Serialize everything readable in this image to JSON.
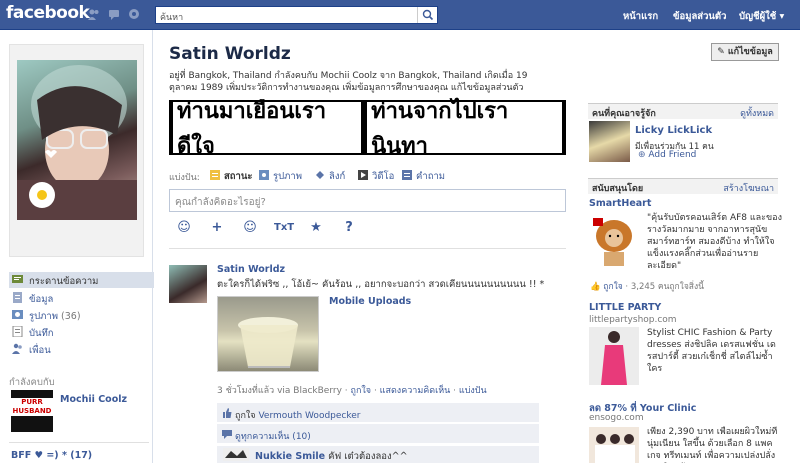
{
  "topbar": {
    "logo": "facebook",
    "search_placeholder": "ค้นหา",
    "nav": [
      "หน้าแรก",
      "ข้อมูลส่วนตัว",
      "บัญชีผู้ใช้ ▾"
    ]
  },
  "profile": {
    "name": "Satin Worldz",
    "info_line1": "อยู่ที่ Bangkok, Thailand   กำลังคบกับ Mochii Coolz   จาก Bangkok, Thailand   เกิดเมื่อ 19",
    "info_line2": "ตุลาคม 1989   เพิ่มประวัติการทำงานของคุณ   เพิ่มข้อมูลการศึกษาของคุณ   แก้ไขข้อมูลส่วนตัว",
    "edit_button": "แก้ไขข้อมูล",
    "banner_tiles": [
      "ท่านมาเยือนเราดีใจ",
      "ท่านจากไปเรานินทา"
    ]
  },
  "left_nav": {
    "items": [
      {
        "label": "กระดานข้อความ",
        "count": ""
      },
      {
        "label": "ข้อมูล",
        "count": ""
      },
      {
        "label": "รูปภาพ",
        "count": "(36)"
      },
      {
        "label": "บันทึก",
        "count": ""
      },
      {
        "label": "เพื่อน",
        "count": ""
      }
    ],
    "relationship_heading": "กำลังคบกับ",
    "relationship_name": "Mochii Coolz",
    "relationship_badge": "PURR HUSBAND",
    "friends_list": "BFF ♥ =) * (17)"
  },
  "composer": {
    "share_label": "แบ่งปัน:",
    "options": [
      "สถานะ",
      "รูปภาพ",
      "ลิงก์",
      "วิดีโอ",
      "คำถาม"
    ],
    "placeholder": "คุณกำลังคิดอะไรอยู่?",
    "tools": [
      "☺",
      "+",
      "☺",
      "TxT",
      "★",
      "?"
    ]
  },
  "story": {
    "author": "Satin Worldz",
    "text": "ตะใครก็ได้ฟริซ ,, โอ้เย้~ คันร้อน ,, อยากจะบอกว่า สวดเคียนนนนนนนนนน !! *",
    "album": "Mobile Uploads",
    "time": "3 ชั่วโมงที่แล้ว via BlackBerry",
    "like": "ถูกใจ",
    "comment": "แสดงความคิดเห็น",
    "share": "แบ่งปัน",
    "likers_prefix": "ถูกใจ",
    "likers_name": "Vermouth Woodpecker",
    "view_comments": "ดูทุกความเห็น (10)",
    "friend_comment_name": "Nukkie Smile",
    "friend_comment_text": "คัฟ เต๋วต้องลอง^^"
  },
  "right": {
    "pymk_heading": "คนที่คุณอาจรู้จัก",
    "pymk_see_all": "ดูทั้งหมด",
    "pymk_name": "Licky LickLick",
    "pymk_mutual": "มีเพื่อนร่วมกัน 11 คน",
    "pymk_add": "Add Friend",
    "sponsored_heading": "สนับสนุนโดย",
    "create_ad": "สร้างโฆษณา",
    "ads": [
      {
        "title": "SmartHeart",
        "url": "",
        "text": "\"คุ้นรับบัตรคอนเสิร์ต AF8 และของรางวัลมากมาย จากอาหารสุนัขสมาร์ทฮาร์ท สมองดีบ้าง ทำให้ใจแข็งแรงคลิ๊กส่วนเพื่ออ่านรายละเอียด\"",
        "like": "ถูกใจ",
        "likes_count": "3,245 คนถูกใจสิ่งนี้"
      },
      {
        "title": "LITTLE PARTY",
        "url": "littlepartyshop.com",
        "text": "Stylist CHIC Fashion & Party dresses ส่งชิปลิค เดรสแฟชั่น เดรสปาร์ตี้ สวยเก๋เช็กชี่ สไตล์ไม่ซ้ำใคร",
        "like": "",
        "likes_count": ""
      },
      {
        "title": "ลด 87% ที่ Your Clinic",
        "url": "ensogo.com",
        "text": "เพียง 2,390 บาท เพื่อเผยผิวใหม่ที่นุ่มเนียน ใสขึ้น ด้วยเลือก 8 แพคเกจ ทรีทเมนท์ เพื่อความเปล่งปลั่งของผิวหน้า",
        "like": "",
        "likes_count": ""
      }
    ]
  }
}
